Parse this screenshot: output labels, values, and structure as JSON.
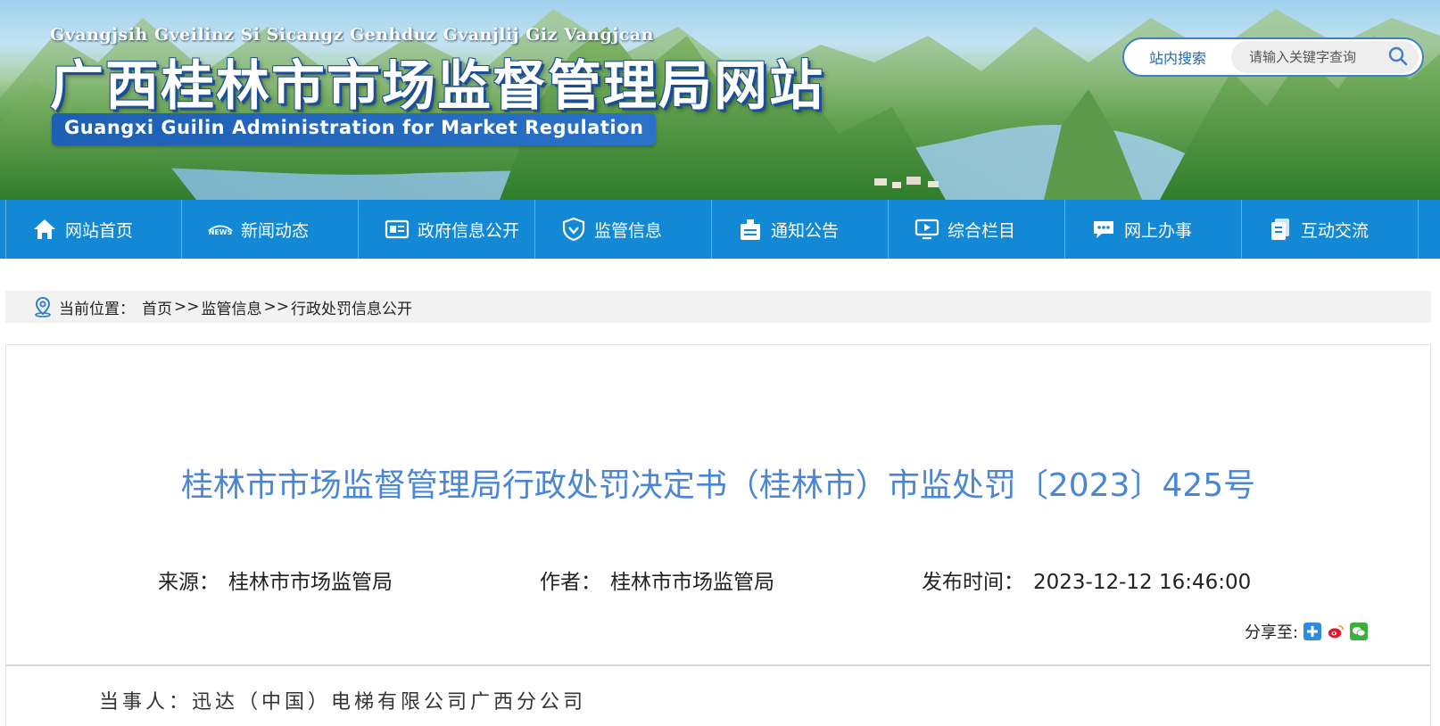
{
  "header": {
    "pinyin": "Gvangjsih Gveilinz Si Sicangz Genhduz Gvanjlij Giz Vangjcan",
    "title": "广西桂林市市场监督管理局网站",
    "english": "Guangxi Guilin Administration for Market Regulation",
    "search_label": "站内搜索",
    "search_placeholder": "请输入关键字查询"
  },
  "nav": {
    "items": [
      {
        "label": "网站首页",
        "icon": "home-icon"
      },
      {
        "label": "新闻动态",
        "icon": "news-icon"
      },
      {
        "label": "政府信息公开",
        "icon": "gov-info-icon"
      },
      {
        "label": "监管信息",
        "icon": "shield-icon"
      },
      {
        "label": "通知公告",
        "icon": "notice-icon"
      },
      {
        "label": "综合栏目",
        "icon": "monitor-icon"
      },
      {
        "label": "网上办事",
        "icon": "chat-icon"
      },
      {
        "label": "互动交流",
        "icon": "document-icon"
      }
    ]
  },
  "breadcrumb": {
    "prefix": "当前位置：",
    "items": [
      "首页",
      "监管信息",
      "行政处罚信息公开"
    ],
    "separator": ">>"
  },
  "article": {
    "title": "桂林市市场监督管理局行政处罚决定书（桂林市）市监处罚〔2023〕425号",
    "source_label": "来源：",
    "source_value": "桂林市市场监管局",
    "author_label": "作者：",
    "author_value": "桂林市市场监管局",
    "date_label": "发布时间：",
    "date_value": "2023-12-12 16:46:00",
    "share_label": "分享至:",
    "share_targets": [
      "qzone-icon",
      "weibo-icon",
      "wechat-icon"
    ],
    "body_first_line": "当事人：迅达（中国）电梯有限公司广西分公司"
  },
  "colors": {
    "nav_bg": "#1389d6",
    "title_color": "#4a86d6",
    "breadcrumb_bg": "#f2f2f2"
  }
}
